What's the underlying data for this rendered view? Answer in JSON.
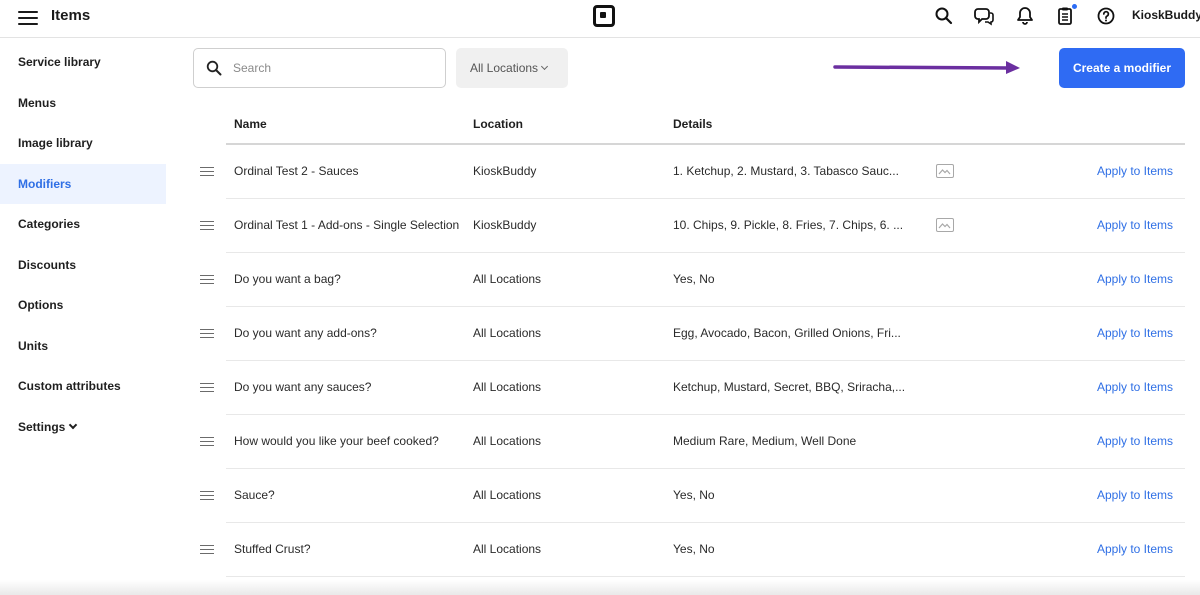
{
  "header": {
    "title": "Items",
    "account_name": "KioskBuddy",
    "icons": [
      "menu-icon",
      "square-logo-icon",
      "search-icon",
      "messages-icon",
      "bell-icon",
      "clipboard-icon",
      "help-icon"
    ]
  },
  "sidebar": {
    "items": [
      {
        "label": "Service library"
      },
      {
        "label": "Menus"
      },
      {
        "label": "Image library"
      },
      {
        "label": "Modifiers",
        "active": true
      },
      {
        "label": "Categories"
      },
      {
        "label": "Discounts"
      },
      {
        "label": "Options"
      },
      {
        "label": "Units"
      },
      {
        "label": "Custom attributes"
      },
      {
        "label": "Settings"
      }
    ]
  },
  "toolbar": {
    "search_placeholder": "Search",
    "location_filter": "All Locations",
    "create_label": "Create a modifier"
  },
  "table": {
    "columns": [
      "Name",
      "Location",
      "Details"
    ],
    "rows": [
      {
        "name": "Ordinal Test 2 - Sauces",
        "location": "KioskBuddy",
        "details": "1. Ketchup, 2. Mustard, 3. Tabasco Sauc...",
        "has_image_icon": true,
        "action": "Apply to Items"
      },
      {
        "name": "Ordinal Test 1 - Add-ons - Single Selection",
        "location": "KioskBuddy",
        "details": "10. Chips, 9. Pickle, 8. Fries, 7. Chips, 6. ...",
        "has_image_icon": true,
        "action": "Apply to Items"
      },
      {
        "name": "Do you want a bag?",
        "location": "All Locations",
        "details": "Yes, No",
        "has_image_icon": false,
        "action": "Apply to Items"
      },
      {
        "name": "Do you want any add-ons?",
        "location": "All Locations",
        "details": "Egg, Avocado, Bacon, Grilled Onions, Fri...",
        "has_image_icon": false,
        "action": "Apply to Items"
      },
      {
        "name": "Do you want any sauces?",
        "location": "All Locations",
        "details": "Ketchup, Mustard, Secret, BBQ, Sriracha,...",
        "has_image_icon": false,
        "action": "Apply to Items"
      },
      {
        "name": "How would you like your beef cooked?",
        "location": "All Locations",
        "details": "Medium Rare, Medium, Well Done",
        "has_image_icon": false,
        "action": "Apply to Items"
      },
      {
        "name": "Sauce?",
        "location": "All Locations",
        "details": "Yes, No",
        "has_image_icon": false,
        "action": "Apply to Items"
      },
      {
        "name": "Stuffed Crust?",
        "location": "All Locations",
        "details": "Yes, No",
        "has_image_icon": false,
        "action": "Apply to Items"
      }
    ]
  },
  "colors": {
    "accent": "#2f6bf3",
    "link": "#2f6fe5",
    "active_bg": "#edf3ff",
    "annotation_arrow": "#6b2fa0"
  }
}
